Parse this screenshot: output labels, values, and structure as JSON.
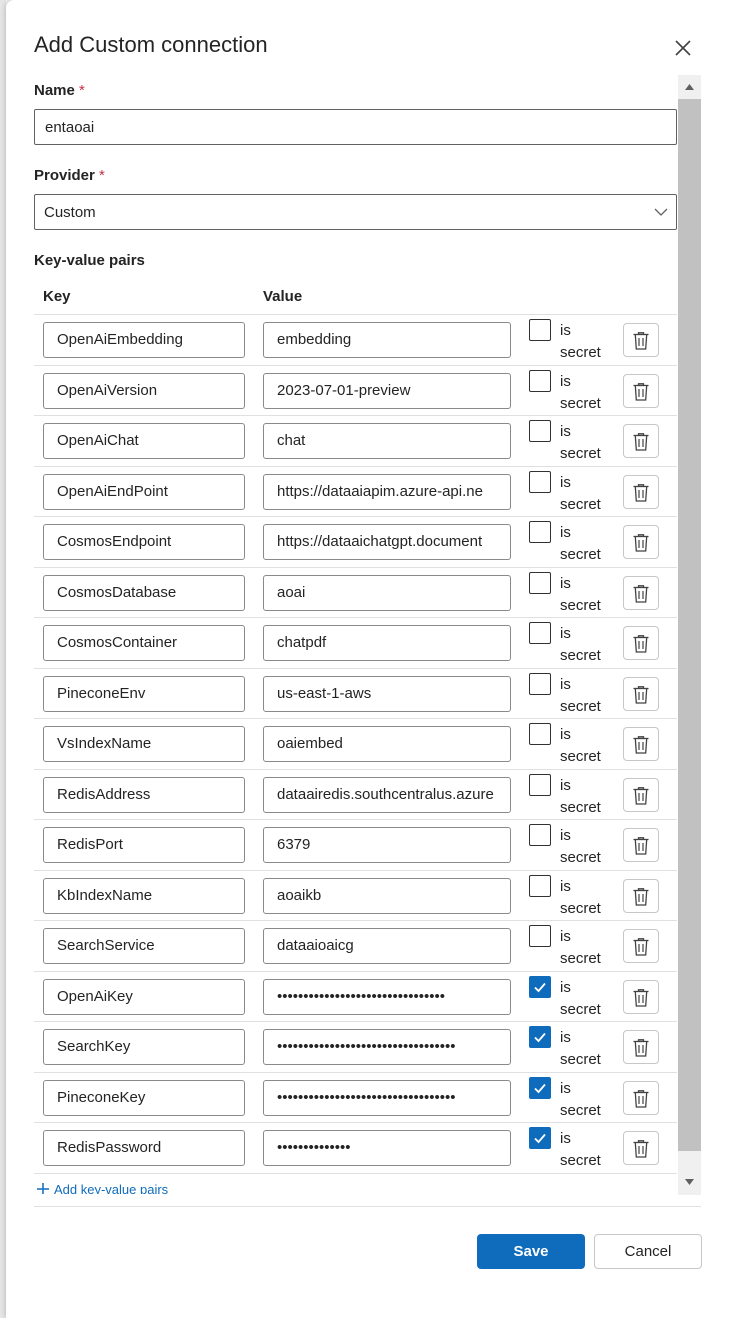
{
  "dialog": {
    "title": "Add Custom connection",
    "name_label": "Name",
    "name_value": "entaoai",
    "provider_label": "Provider",
    "required_marker": "*",
    "provider_value": "Custom",
    "kv_section_title": "Key-value pairs",
    "col_key": "Key",
    "col_value": "Value",
    "secret_label_line1": "is",
    "secret_label_line2": "secret",
    "add_link_label": "Add key-value pairs",
    "save_label": "Save",
    "cancel_label": "Cancel",
    "accent_color": "#0f6cbd",
    "required_color": "#c4314b"
  },
  "pairs": [
    {
      "key": "OpenAiEmbedding",
      "value": "embedding",
      "secret": false
    },
    {
      "key": "OpenAiVersion",
      "value": "2023-07-01-preview",
      "secret": false
    },
    {
      "key": "OpenAiChat",
      "value": "chat",
      "secret": false
    },
    {
      "key": "OpenAiEndPoint",
      "value": "https://dataaiapim.azure-api.ne",
      "secret": false
    },
    {
      "key": "CosmosEndpoint",
      "value": "https://dataaichatgpt.document",
      "secret": false
    },
    {
      "key": "CosmosDatabase",
      "value": "aoai",
      "secret": false
    },
    {
      "key": "CosmosContainer",
      "value": "chatpdf",
      "secret": false
    },
    {
      "key": "PineconeEnv",
      "value": "us-east-1-aws",
      "secret": false
    },
    {
      "key": "VsIndexName",
      "value": "oaiembed",
      "secret": false
    },
    {
      "key": "RedisAddress",
      "value": "dataairedis.southcentralus.azure",
      "secret": false
    },
    {
      "key": "RedisPort",
      "value": "6379",
      "secret": false
    },
    {
      "key": "KbIndexName",
      "value": "aoaikb",
      "secret": false
    },
    {
      "key": "SearchService",
      "value": "dataaioaicg",
      "secret": false
    },
    {
      "key": "OpenAiKey",
      "value": "••••••••••••••••••••••••••••••••",
      "secret": true
    },
    {
      "key": "SearchKey",
      "value": "••••••••••••••••••••••••••••••••••",
      "secret": true
    },
    {
      "key": "PineconeKey",
      "value": "••••••••••••••••••••••••••••••••••",
      "secret": true
    },
    {
      "key": "RedisPassword",
      "value": "••••••••••••••",
      "secret": true
    }
  ],
  "icons": {
    "close": "close-icon",
    "chevron": "chevron-down-icon",
    "delete": "trash-icon",
    "check": "checkmark-icon",
    "add": "plus-icon"
  }
}
